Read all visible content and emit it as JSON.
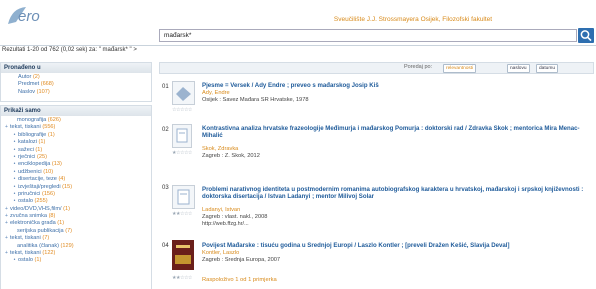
{
  "header": {
    "logo": "ero",
    "institution": "Sveučilište J.J. Strossmayera Osijek, Filozofski fakultet",
    "search_value": "mađarsk*",
    "results_summary": "Rezultati 1-20 od 762 (0,02 sek) za: \" mađarsk* \" >"
  },
  "sidebar": {
    "found_title": "Pronađeno u",
    "found_items": [
      {
        "label": "Autor",
        "count": "(2)"
      },
      {
        "label": "Predmet",
        "count": "(668)"
      },
      {
        "label": "Naslov",
        "count": "(107)"
      }
    ],
    "show_title": "Prikaži samo",
    "show_items": [
      {
        "label": "monografija",
        "count": "(626)",
        "bullet": ""
      },
      {
        "label": "tekst, tiskani",
        "count": "(556)",
        "bullet": "+"
      },
      {
        "label": "bibliografije",
        "count": "(1)",
        "bullet": "•"
      },
      {
        "label": "katalozi",
        "count": "(1)",
        "bullet": "•"
      },
      {
        "label": "sažeci",
        "count": "(1)",
        "bullet": "•"
      },
      {
        "label": "rječnici",
        "count": "(25)",
        "bullet": "•"
      },
      {
        "label": "enciklopedija",
        "count": "(13)",
        "bullet": "•"
      },
      {
        "label": "udžbenici",
        "count": "(10)",
        "bullet": "•"
      },
      {
        "label": "disertacije, teze",
        "count": "(4)",
        "bullet": "•"
      },
      {
        "label": "izvještaji/pregledi",
        "count": "(15)",
        "bullet": "•"
      },
      {
        "label": "priručnici",
        "count": "(156)",
        "bullet": "•"
      },
      {
        "label": "ostalo",
        "count": "(255)",
        "bullet": "•"
      },
      {
        "label": "video/DVD,VHS,film/",
        "count": "(1)",
        "bullet": "+"
      },
      {
        "label": "zvučna snimka",
        "count": "(8)",
        "bullet": "+"
      },
      {
        "label": "elektronička građa",
        "count": "(1)",
        "bullet": "+"
      },
      {
        "label": "serijska publikacija",
        "count": "(7)",
        "bullet": ""
      },
      {
        "label": "tekst, tiskani",
        "count": "(7)",
        "bullet": "+"
      },
      {
        "label": "analitika (članak)",
        "count": "(129)",
        "bullet": ""
      },
      {
        "label": "tekst, tiskani",
        "count": "(122)",
        "bullet": "+"
      },
      {
        "label": "ostalo",
        "count": "(1)",
        "bullet": "•"
      }
    ]
  },
  "results": {
    "sort_label": "Poredaj po:",
    "sort_options": [
      "relevantnosti",
      "naslovu",
      "datumu"
    ],
    "items": [
      {
        "num": "01",
        "title": "Pjesme = Versek / Ady Endre ; preveo s mađarskog Josip Kiš",
        "author": "Ady, Endre",
        "publisher": "Osijek : Savez Mađara SR Hrvatske, 1978",
        "stars": "☆☆☆☆☆"
      },
      {
        "num": "02",
        "title": "Kontrastivna analiza hrvatske frazeologije Međimurja i mađarskog Pomurja : doktorski rad / Zdravka Skok ; mentorica Mira Menac-Mihalić",
        "author": "Skok, Zdravka",
        "publisher": "Zagreb : Z. Skok, 2012",
        "stars": "★☆☆☆☆"
      },
      {
        "num": "03",
        "title": "Problemi narativnog identiteta u postmodernim romanima autobiografskog karaktera u hrvatskoj, mađarskoj i srpskoj književnosti : doktorska disertacija / Istvan Ladanyi ; mentor Milivoj Solar",
        "author": "Ladanyi, Istvan",
        "publisher": "Zagreb : vlast. nakl., 2008",
        "url": "http://web.ffzg.hr/...",
        "stars": "★★☆☆☆"
      },
      {
        "num": "04",
        "title": "Povijest Mađarske : tisuću godina u Srednjoj Europi / Laszlo Kontler ; [preveli Dražen Kešić, Slavija Deval]",
        "author": "Kontler, Laszlo",
        "publisher": "Zagreb : Srednja Europa, 2007",
        "stars": "★★☆☆☆"
      }
    ],
    "footer_count": "Raspoloživo 1 od 1 primjerka"
  }
}
